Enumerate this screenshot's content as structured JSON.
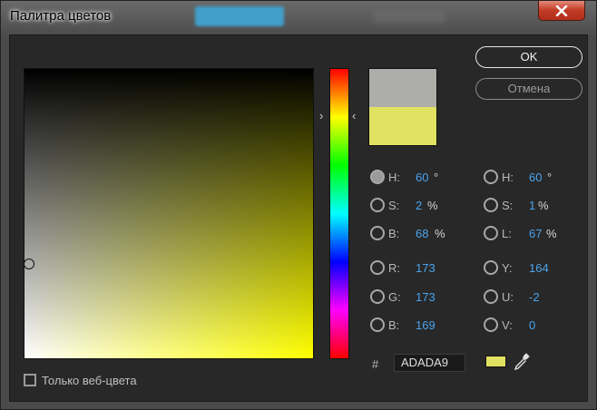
{
  "window": {
    "title": "Палитра цветов"
  },
  "buttons": {
    "ok": "OK",
    "cancel": "Отмена"
  },
  "colors": {
    "new_color": "#ADADA9",
    "current_color": "#E2E262"
  },
  "hsb": [
    {
      "label": "H:",
      "value": "60",
      "unit": "°",
      "selected": true
    },
    {
      "label": "S:",
      "value": "2",
      "unit": "%",
      "selected": false
    },
    {
      "label": "B:",
      "value": "68",
      "unit": "%",
      "selected": false
    }
  ],
  "hsl": [
    {
      "label": "H:",
      "value": "60",
      "unit": "°",
      "selected": false
    },
    {
      "label": "S:",
      "value": "1",
      "unit": "%",
      "selected": false
    },
    {
      "label": "L:",
      "value": "67",
      "unit": "%",
      "selected": false
    }
  ],
  "rgb": [
    {
      "label": "R:",
      "value": "173",
      "selected": false
    },
    {
      "label": "G:",
      "value": "173",
      "selected": false
    },
    {
      "label": "B:",
      "value": "169",
      "selected": false
    }
  ],
  "yuv": [
    {
      "label": "Y:",
      "value": "164",
      "selected": false
    },
    {
      "label": "U:",
      "value": "-2",
      "selected": false
    },
    {
      "label": "V:",
      "value": "0",
      "selected": false
    }
  ],
  "hex": {
    "symbol": "#",
    "value": "ADADA9"
  },
  "web_colors": {
    "label": "Только веб-цвета",
    "checked": false
  }
}
